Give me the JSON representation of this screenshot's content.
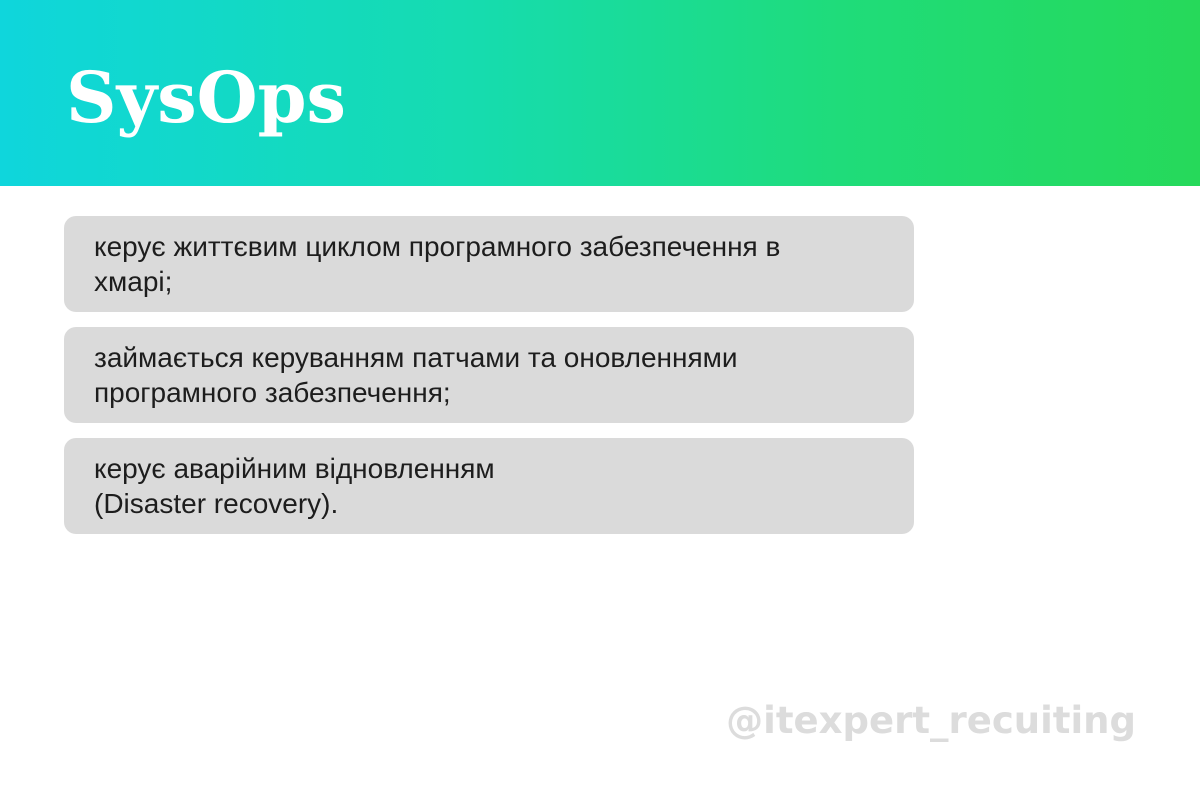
{
  "header": {
    "title": "SysOps",
    "gradient_start": "#0fd6dc",
    "gradient_end": "#26d95a"
  },
  "cards": [
    {
      "text": "керує життєвим циклом програмного забезпечення в\nхмарі;"
    },
    {
      "text": "займається керуванням патчами та оновленнями\nпрограмного забезпечення;"
    },
    {
      "text": "керує аварійним відновленням\n(Disaster recovery)."
    }
  ],
  "watermark": {
    "text": "@itexpert_recuiting"
  },
  "colors": {
    "card_background": "#dadada",
    "text": "#1d1d1d",
    "watermark": "#dcdcdc"
  }
}
